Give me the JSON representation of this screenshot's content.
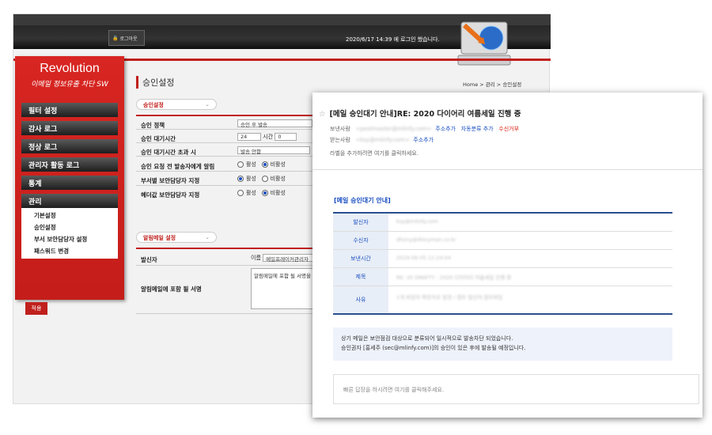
{
  "topbar": {
    "logout": "로그아웃",
    "login_info": "2020/6/17 14:39 에 로그인 했습니다."
  },
  "brand": {
    "name": "Revolution",
    "tagline": "이메일 정보유출 차단 SW"
  },
  "sidebar": {
    "items": [
      {
        "label": "필터 설정"
      },
      {
        "label": "감사 로그"
      },
      {
        "label": "정상 로그"
      },
      {
        "label": "관리자 활동 로그"
      },
      {
        "label": "통계"
      },
      {
        "label": "관리"
      }
    ],
    "subitems": [
      {
        "label": "기본설정"
      },
      {
        "label": "승인설정"
      },
      {
        "label": "부서 보안담당자 설정"
      },
      {
        "label": "패스워드 변경"
      }
    ]
  },
  "main": {
    "title": "승인설정",
    "breadcrumb": "Home > 관리 > 승인설정",
    "section1": "승인설정",
    "section2": "알림메일 설정",
    "rows": {
      "policy": "승인 정책",
      "policy_value": "승인 후 발송",
      "wait": "승인 대기시간",
      "wait_hours": "24",
      "wait_unit": "시간",
      "wait_min": "0",
      "exceed": "승인 대기시간 초과 시",
      "exceed_value": "발송 안함",
      "notify": "승인 요청 전 발송자에게 알림",
      "dept": "부서별 보안담당자 지정",
      "default": "헤더값 보안담당자 지정",
      "on": "활성",
      "off": "비활성",
      "sender": "발신자",
      "sender_name": "이름",
      "sender_value": "메일프레이커관리자",
      "signature": "알림메일에 포함 될 서명",
      "signature_value": "알림메일에 포함 될 서명을"
    },
    "apply": "적용"
  },
  "mail": {
    "subject": "[메일 승인대기 안내]RE: 2020 다이어리 여름세일 진행 중",
    "from_label": "보낸사람",
    "from": "<postmaster@mlinfy.com>",
    "add_addr": "주소추가",
    "auto_class": "자동분류 추가",
    "reject": "수신거부",
    "to_label": "받는사람",
    "to": "<ksy@mlinfy.com>",
    "label_hint": "라벨을 추가하려면 여기를 클릭하세요.",
    "body_title": "[메일 승인대기 안내]",
    "table": [
      {
        "k": "발신자",
        "v": "ksy@mlinfy.com"
      },
      {
        "k": "수신자",
        "v": "dhony@diaryman.co.kr"
      },
      {
        "k": "보낸시간",
        "v": "2019-06-05 11:24:04"
      },
      {
        "k": "제목",
        "v": "RE: 20 DRAFTY : 2020 다이어리 여름세일 진행 중"
      },
      {
        "k": "사유",
        "v": "1개 파일의 확장자로 발견 / 첨부 발신자,첨부파일"
      }
    ],
    "note1": "상기 메일은 보안점검 대상으로 분류되어 일시적으로 발송차단 되었습니다.",
    "note2": "승인권자 [홍세주 (sec@mlinfy.com)]의 승인이 있은 후에 발송될 예정입니다.",
    "reply": "빠른 답장을 하시려면 여기를 클릭해주세요."
  },
  "colors": {
    "accent": "#c0201d",
    "link": "#1a4fc2"
  }
}
